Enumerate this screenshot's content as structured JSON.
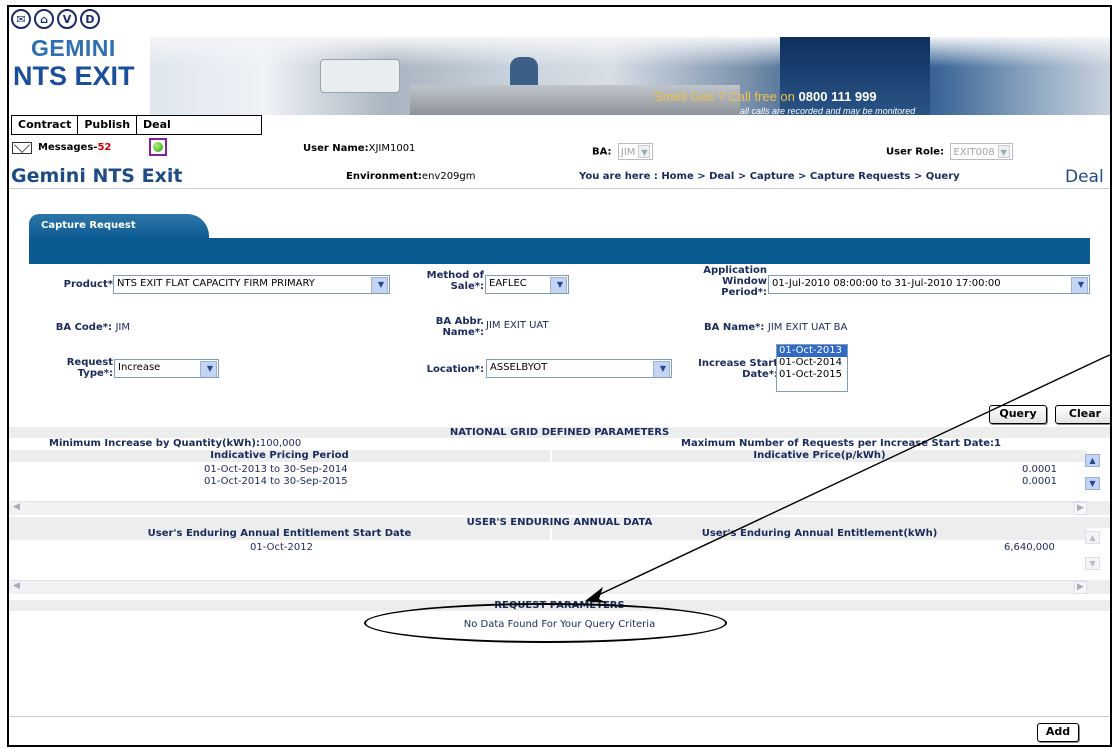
{
  "header": {
    "icons": [
      "E",
      "home-icon",
      "V",
      "D"
    ],
    "logo_line1": "GEMINI",
    "logo_line2": "NTS EXIT",
    "banner_main": "Smell Gas ? Call free on",
    "banner_phone": "0800 111 999",
    "banner_sub": "all calls are recorded and may be monitored"
  },
  "menu": {
    "items": [
      "Contract",
      "Publish",
      "Deal"
    ]
  },
  "messages": {
    "label": "Messages-",
    "count": "52"
  },
  "user": {
    "username_label": "User Name:",
    "username": "XJIM1001",
    "ba_label": "BA:",
    "ba_value": "JIM",
    "role_label": "User Role:",
    "role_value": "EXIT008"
  },
  "titlebar": {
    "title": "Gemini NTS Exit",
    "env_label": "Environment:",
    "env_value": "env209gm",
    "breadcrumb": "You are here : Home > Deal > Capture > Capture Requests > Query",
    "section": "Deal"
  },
  "tab": {
    "label": "Capture Request"
  },
  "form": {
    "product_label": "Product*:",
    "product_value": "NTS EXIT FLAT CAPACITY FIRM PRIMARY",
    "mos_label1": "Method of",
    "mos_label2": "Sale*:",
    "mos_value": "EAFLEC",
    "awp_label1": "Application",
    "awp_label2": "Window",
    "awp_label3": "Period*:",
    "awp_value": "01-Jul-2010 08:00:00 to 31-Jul-2010 17:00:00",
    "bacode_label": "BA Code*:",
    "bacode_value": "JIM",
    "baabbr_label1": "BA Abbr.",
    "baabbr_label2": "Name*:",
    "baabbr_value": "JIM EXIT UAT",
    "baname_label": "BA Name*:",
    "baname_value": "JIM EXIT UAT BA",
    "reqtype_label1": "Request",
    "reqtype_label2": "Type*:",
    "reqtype_value": "Increase",
    "location_label": "Location*:",
    "location_value": "ASSELBYOT",
    "isd_label1": "Increase Start",
    "isd_label2": "Date*:",
    "isd_options": [
      "01-Oct-2013",
      "01-Oct-2014",
      "01-Oct-2015"
    ],
    "query_button": "Query",
    "clear_button": "Clear"
  },
  "ng_params": {
    "title": "NATIONAL GRID DEFINED PARAMETERS",
    "min_label": "Minimum Increase by Quantity(kWh):",
    "min_value": "100,000",
    "max_label": "Maximum Number of Requests per Increase Start Date:",
    "max_value": "1",
    "columns": [
      "Indicative Pricing Period",
      "Indicative Price(p/kWh)"
    ],
    "rows": [
      {
        "period": "01-Oct-2013 to 30-Sep-2014",
        "price": "0.0001"
      },
      {
        "period": "01-Oct-2014 to 30-Sep-2015",
        "price": "0.0001"
      }
    ]
  },
  "annual": {
    "title": "USER'S ENDURING ANNUAL DATA",
    "columns": [
      "User's Enduring Annual Entitlement Start Date",
      "User's Enduring Annual Entitlement(kWh)"
    ],
    "rows": [
      {
        "date": "01-Oct-2012",
        "value": "6,640,000"
      }
    ]
  },
  "request": {
    "title": "REQUEST PARAMETERS",
    "empty": "No Data Found For Your Query Criteria"
  },
  "add_button": "Add"
}
